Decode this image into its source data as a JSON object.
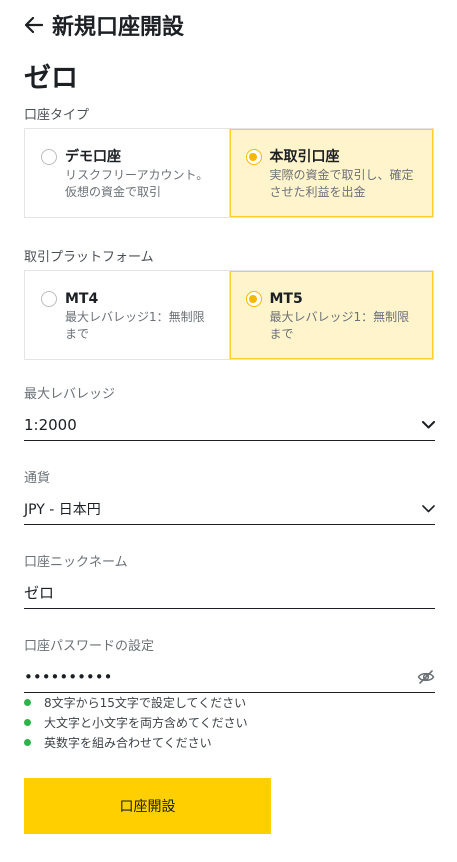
{
  "header": {
    "title": "新規口座開設"
  },
  "account_type_name": "ゼロ",
  "account_type_section": {
    "label": "口座タイプ",
    "options": [
      {
        "title": "デモ口座",
        "desc": "リスクフリーアカウント。仮想の資金で取引",
        "selected": false
      },
      {
        "title": "本取引口座",
        "desc": "実際の資金で取引し、確定させた利益を出金",
        "selected": true
      }
    ]
  },
  "platform_section": {
    "label": "取引プラットフォーム",
    "options": [
      {
        "title": "MT4",
        "desc": "最大レバレッジ1：無制限まで",
        "selected": false
      },
      {
        "title": "MT5",
        "desc": "最大レバレッジ1：無制限まで",
        "selected": true
      }
    ]
  },
  "leverage": {
    "label": "最大レバレッジ",
    "value": "1:2000"
  },
  "currency": {
    "label": "通貨",
    "value": "JPY - 日本円"
  },
  "nickname": {
    "label": "口座ニックネーム",
    "value": "ゼロ"
  },
  "password": {
    "label": "口座パスワードの設定",
    "value": "••••••••••",
    "rules": [
      "8文字から15文字で設定してください",
      "大文字と小文字を両方含めてください",
      "英数字を組み合わせてください"
    ]
  },
  "submit": {
    "label": "口座開設"
  },
  "colors": {
    "accent": "#ffcf00",
    "selected_bg": "#fff4cc",
    "rule_ok": "#2db34a"
  }
}
